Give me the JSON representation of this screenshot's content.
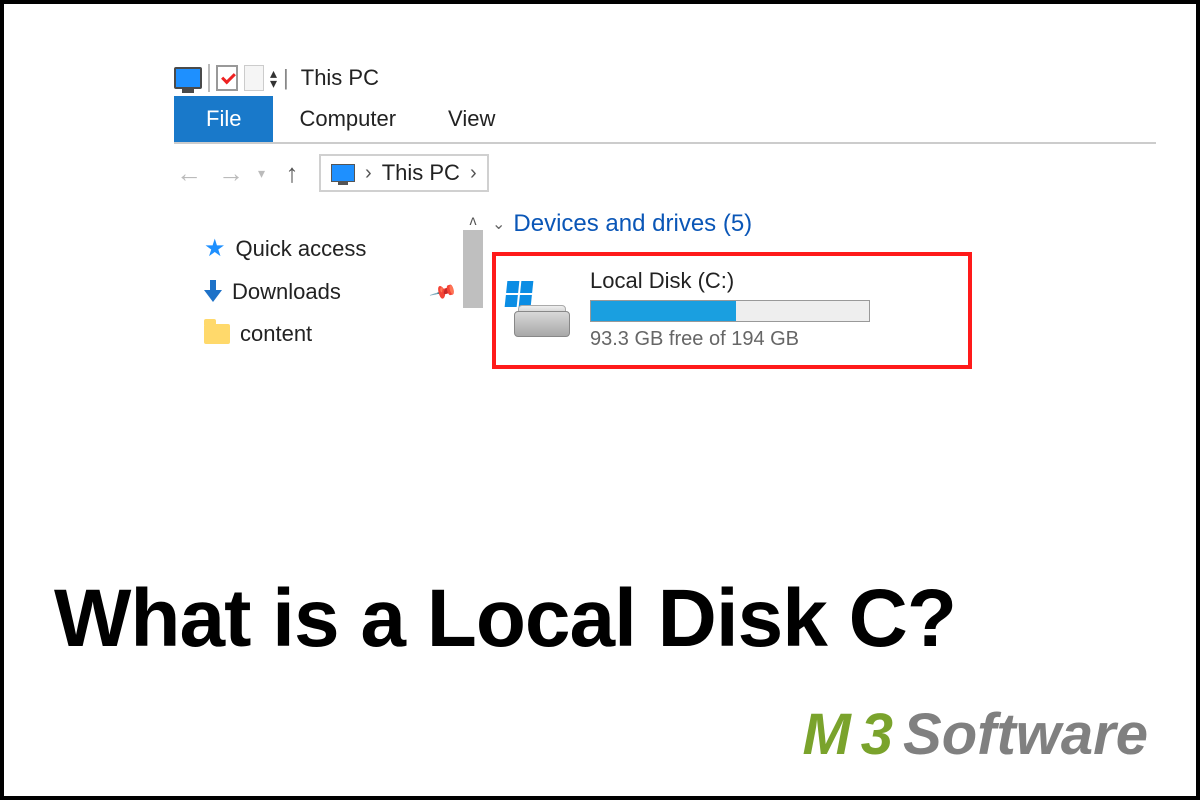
{
  "titlebar": {
    "title": "This PC"
  },
  "ribbon": {
    "file": "File",
    "tabs": [
      "Computer",
      "View"
    ]
  },
  "address": {
    "location": "This PC"
  },
  "sidebar": {
    "items": [
      {
        "label": "Quick access"
      },
      {
        "label": "Downloads"
      },
      {
        "label": "content"
      }
    ]
  },
  "content": {
    "group_header": "Devices and drives (5)",
    "drive": {
      "name": "Local Disk (C:)",
      "free_text": "93.3 GB free of 194 GB",
      "fill_percent": 52
    }
  },
  "headline": "What is a Local Disk C?",
  "brand": {
    "m": "M",
    "three": "3",
    "name": "Software"
  }
}
